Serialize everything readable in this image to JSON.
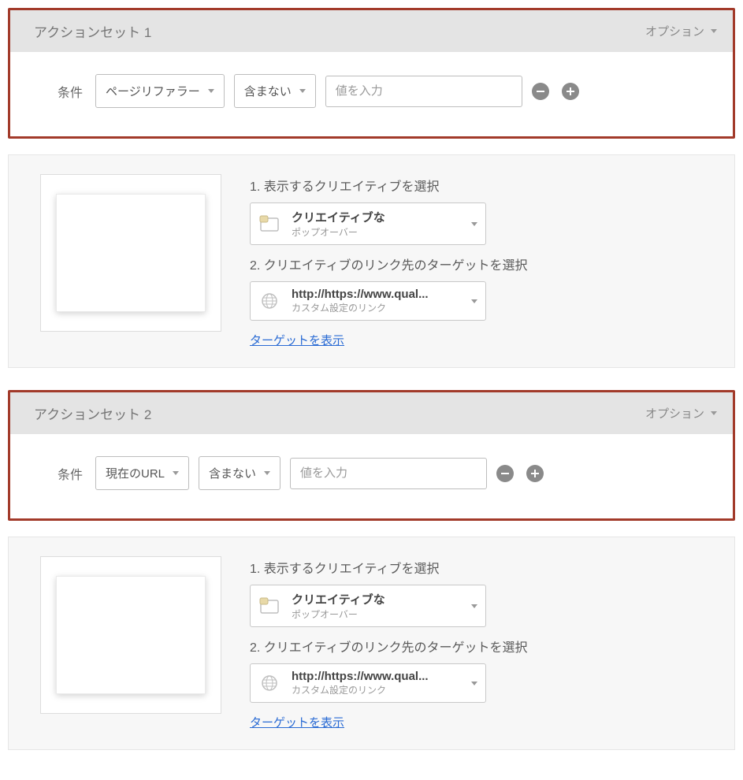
{
  "common": {
    "options_label": "オプション",
    "condition_label": "条件",
    "condition_operator": "含まない",
    "value_placeholder": "値を入力",
    "step1_label": "1. 表示するクリエイティブを選択",
    "step2_label": "2. クリエイティブのリンク先のターゲットを選択",
    "creative_title": "クリエイティブな",
    "creative_subtitle": "ポップオーバー",
    "target_url": "http://https://www.qual...",
    "target_subtitle": "カスタム設定のリンク",
    "view_target_link": "ターゲットを表示"
  },
  "sets": [
    {
      "title": "アクションセット 1",
      "condition_field": "ページリファラー"
    },
    {
      "title": "アクションセット 2",
      "condition_field": "現在のURL"
    }
  ]
}
